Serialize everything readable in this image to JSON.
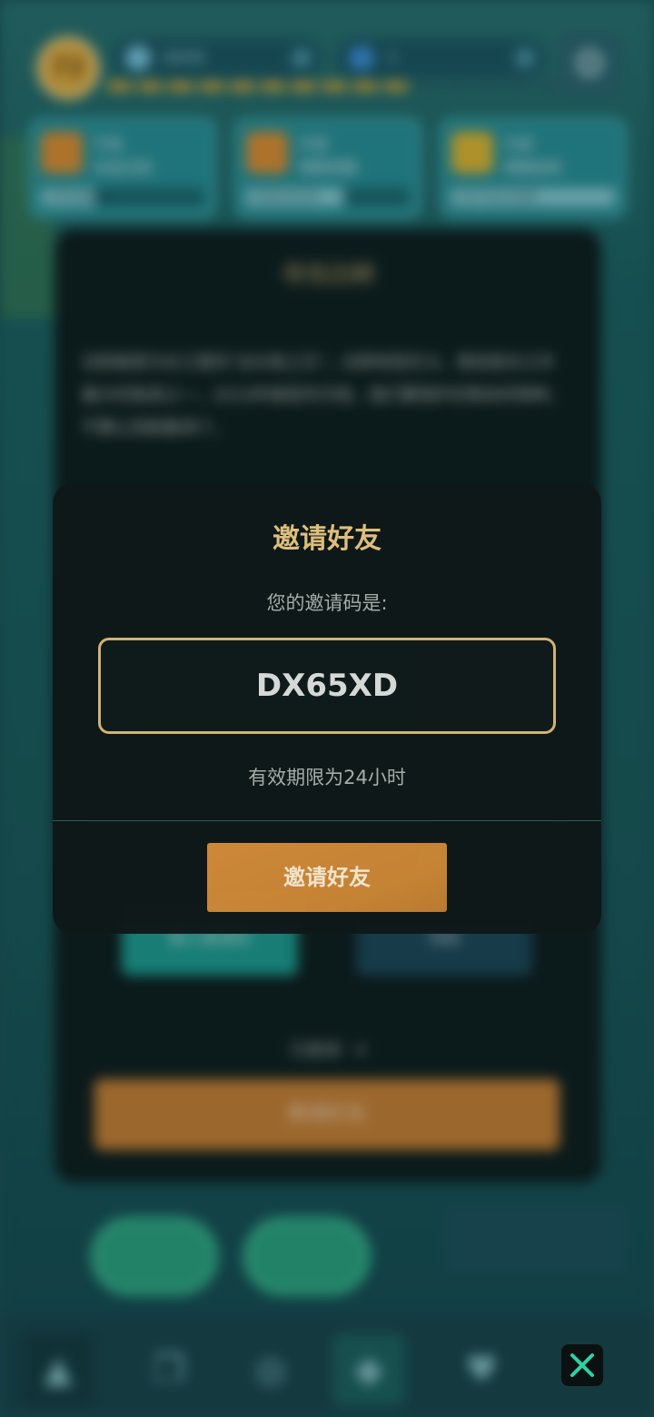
{
  "dialog": {
    "title": "邀请好友",
    "prompt": "您的邀请码是:",
    "invite_code": "DX65XD",
    "validity": "有效期限为24小时",
    "invite_button_label": "邀请好友"
  },
  "background": {
    "level": "72",
    "water_count": "6606",
    "gem_count": "1",
    "task_cards": [
      {
        "line1": "升级",
        "line2": "白金石斑",
        "progress": "2751/8000"
      },
      {
        "line1": "升级",
        "line2": "黄鳍青鲷",
        "progress": "3181/5218"
      },
      {
        "line1": "升级",
        "line2": "黄鳍金枪",
        "progress": "31772/11000"
      }
    ],
    "underlying_dialog": {
      "title": "寻找白鲟",
      "description": "白鲟被誉为长江里的\"淡水鱼之王\"，白鲟体型巨大，曾经是长江中最大的鱼类之一，2019年被宣布灭绝，我们要保护好剩余的物种，不要让悲剧重演了。",
      "count_label": "已邀请：4",
      "button_a": "输入邀请码",
      "button_b": "领取",
      "invite_label": "邀请好友"
    }
  },
  "colors": {
    "accent_gold": "#e2c27e",
    "button_orange": "#d18b3a",
    "dialog_bg": "#0f1818",
    "close_icon": "#2fd0a6"
  }
}
